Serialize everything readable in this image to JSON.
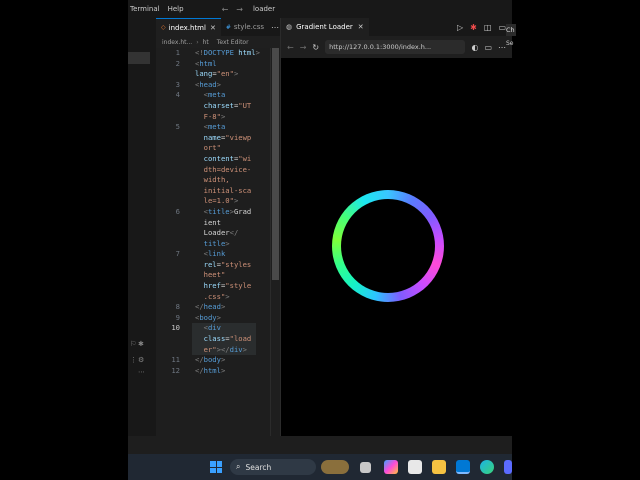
{
  "titlebar": {
    "menu": [
      "Terminal",
      "Help"
    ],
    "search_text": "loader"
  },
  "editor": {
    "tabs": [
      {
        "label": "index.html",
        "active": true
      },
      {
        "label": "style.css",
        "active": false
      }
    ],
    "breadcrumb": [
      "index.ht...",
      "ht",
      "Text Editor"
    ],
    "lines": [
      {
        "n": "1",
        "segs": [
          [
            "punct",
            "<!"
          ],
          [
            "tag",
            "DOCTYPE"
          ],
          [
            "attr",
            " html"
          ],
          [
            "punct",
            ">"
          ]
        ]
      },
      {
        "n": "2",
        "segs": [
          [
            "punct",
            "<"
          ],
          [
            "tag",
            "html"
          ]
        ]
      },
      {
        "n": "",
        "segs": [
          [
            "attr",
            "lang"
          ],
          [
            "plain",
            "="
          ],
          [
            "str",
            "\"en\""
          ],
          [
            "punct",
            ">"
          ]
        ]
      },
      {
        "n": "3",
        "segs": [
          [
            "punct",
            "<"
          ],
          [
            "tag",
            "head"
          ],
          [
            "punct",
            ">"
          ]
        ]
      },
      {
        "n": "4",
        "segs": [
          [
            "plain",
            "  "
          ],
          [
            "punct",
            "<"
          ],
          [
            "tag",
            "meta"
          ]
        ]
      },
      {
        "n": "",
        "segs": [
          [
            "plain",
            "  "
          ],
          [
            "attr",
            "charset"
          ],
          [
            "plain",
            "="
          ],
          [
            "str",
            "\"UT"
          ]
        ]
      },
      {
        "n": "",
        "segs": [
          [
            "plain",
            "  "
          ],
          [
            "str",
            "F-8\""
          ],
          [
            "punct",
            ">"
          ]
        ]
      },
      {
        "n": "5",
        "segs": [
          [
            "plain",
            "  "
          ],
          [
            "punct",
            "<"
          ],
          [
            "tag",
            "meta"
          ]
        ]
      },
      {
        "n": "",
        "segs": [
          [
            "plain",
            "  "
          ],
          [
            "attr",
            "name"
          ],
          [
            "plain",
            "="
          ],
          [
            "str",
            "\"viewp"
          ]
        ]
      },
      {
        "n": "",
        "segs": [
          [
            "plain",
            "  "
          ],
          [
            "str",
            "ort\""
          ]
        ]
      },
      {
        "n": "",
        "segs": [
          [
            "plain",
            "  "
          ],
          [
            "attr",
            "content"
          ],
          [
            "plain",
            "="
          ],
          [
            "str",
            "\"wi"
          ]
        ]
      },
      {
        "n": "",
        "segs": [
          [
            "plain",
            "  "
          ],
          [
            "str",
            "dth=device-"
          ]
        ]
      },
      {
        "n": "",
        "segs": [
          [
            "plain",
            "  "
          ],
          [
            "str",
            "width,"
          ]
        ]
      },
      {
        "n": "",
        "segs": [
          [
            "plain",
            "  "
          ],
          [
            "str",
            "initial-sca"
          ]
        ]
      },
      {
        "n": "",
        "segs": [
          [
            "plain",
            "  "
          ],
          [
            "str",
            "le=1.0\""
          ],
          [
            "punct",
            ">"
          ]
        ]
      },
      {
        "n": "6",
        "segs": [
          [
            "plain",
            "  "
          ],
          [
            "punct",
            "<"
          ],
          [
            "tag",
            "title"
          ],
          [
            "punct",
            ">"
          ],
          [
            "plain",
            "Grad"
          ]
        ]
      },
      {
        "n": "",
        "segs": [
          [
            "plain",
            "  "
          ],
          [
            "plain",
            "ient"
          ]
        ]
      },
      {
        "n": "",
        "segs": [
          [
            "plain",
            "  "
          ],
          [
            "plain",
            "Loader"
          ],
          [
            "punct",
            "</"
          ]
        ]
      },
      {
        "n": "",
        "segs": [
          [
            "plain",
            "  "
          ],
          [
            "tag",
            "title"
          ],
          [
            "punct",
            ">"
          ]
        ]
      },
      {
        "n": "7",
        "segs": [
          [
            "plain",
            "  "
          ],
          [
            "punct",
            "<"
          ],
          [
            "tag",
            "link"
          ]
        ]
      },
      {
        "n": "",
        "segs": [
          [
            "plain",
            "  "
          ],
          [
            "attr",
            "rel"
          ],
          [
            "plain",
            "="
          ],
          [
            "str",
            "\"styles"
          ]
        ]
      },
      {
        "n": "",
        "segs": [
          [
            "plain",
            "  "
          ],
          [
            "str",
            "heet\""
          ]
        ]
      },
      {
        "n": "",
        "segs": [
          [
            "plain",
            "  "
          ],
          [
            "attr",
            "href"
          ],
          [
            "plain",
            "="
          ],
          [
            "str",
            "\"style"
          ]
        ]
      },
      {
        "n": "",
        "segs": [
          [
            "plain",
            "  "
          ],
          [
            "str",
            ".css\""
          ],
          [
            "punct",
            ">"
          ]
        ]
      },
      {
        "n": "8",
        "segs": [
          [
            "punct",
            "</"
          ],
          [
            "tag",
            "head"
          ],
          [
            "punct",
            ">"
          ]
        ]
      },
      {
        "n": "9",
        "segs": [
          [
            "punct",
            "<"
          ],
          [
            "tag",
            "body"
          ],
          [
            "punct",
            ">"
          ]
        ]
      },
      {
        "n": "10",
        "segs": [
          [
            "plain",
            "  "
          ],
          [
            "punct",
            "<"
          ],
          [
            "tag",
            "div"
          ]
        ],
        "active": true
      },
      {
        "n": "",
        "segs": [
          [
            "plain",
            "  "
          ],
          [
            "attr",
            "class"
          ],
          [
            "plain",
            "="
          ],
          [
            "str",
            "\"load"
          ]
        ],
        "active": true
      },
      {
        "n": "",
        "segs": [
          [
            "plain",
            "  "
          ],
          [
            "str",
            "er\""
          ],
          [
            "punct",
            "></"
          ],
          [
            "tag",
            "div"
          ],
          [
            "punct",
            ">"
          ]
        ],
        "active": true
      },
      {
        "n": "11",
        "segs": [
          [
            "punct",
            "</"
          ],
          [
            "tag",
            "body"
          ],
          [
            "punct",
            ">"
          ]
        ]
      },
      {
        "n": "12",
        "segs": [
          [
            "punct",
            "</"
          ],
          [
            "tag",
            "html"
          ],
          [
            "punct",
            ">"
          ]
        ]
      }
    ]
  },
  "browser": {
    "tab_label": "Gradient Loader",
    "url": "http://127.0.0.1:3000/index.h...",
    "loader_colors": [
      "#3ac6ff",
      "#c94cff",
      "#ff4bd8",
      "#33ff8a"
    ]
  },
  "taskbar": {
    "search_label": "Search"
  },
  "right_panel": {
    "label_top": "Ch",
    "label_sub": "Se"
  },
  "colors": {
    "editor_bg": "#1e1e1e",
    "tag": "#569cd6",
    "attr": "#9cdcfe",
    "string": "#ce9178",
    "accent": "#0078d4"
  }
}
